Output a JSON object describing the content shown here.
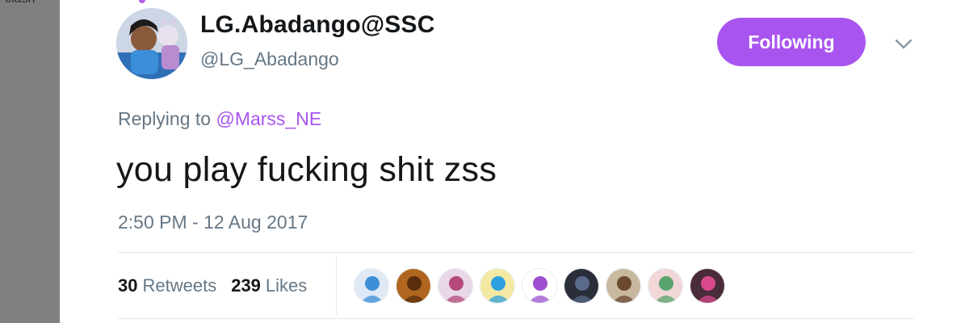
{
  "sidebar": {
    "partial_text": "clash"
  },
  "tweet": {
    "display_name": "LG.Abadango@SSC",
    "username": "@LG_Abadango",
    "follow_button": "Following",
    "replying_prefix": "Replying to",
    "replying_to": "@Marss_NE",
    "text": "you play fucking shit zss",
    "timestamp": "2:50 PM - 12 Aug 2017",
    "retweets_count": "30",
    "retweets_label": "Retweets",
    "likes_count": "239",
    "likes_label": "Likes"
  },
  "likers": [
    {
      "icon": "liker-avatar-1",
      "colors": [
        "#dfe9f5",
        "#3a8fd6"
      ]
    },
    {
      "icon": "liker-avatar-2",
      "colors": [
        "#b0661e",
        "#5a2d0c"
      ]
    },
    {
      "icon": "liker-avatar-3",
      "colors": [
        "#e8d7e6",
        "#b3497c"
      ]
    },
    {
      "icon": "liker-avatar-4",
      "colors": [
        "#f4e9a3",
        "#2ea0e0"
      ]
    },
    {
      "icon": "liker-avatar-5",
      "colors": [
        "#ffffff",
        "#9b4fcf"
      ]
    },
    {
      "icon": "liker-avatar-6",
      "colors": [
        "#2a2d3a",
        "#5a6a8a"
      ]
    },
    {
      "icon": "liker-avatar-7",
      "colors": [
        "#c8b8a0",
        "#6b4a30"
      ]
    },
    {
      "icon": "liker-avatar-8",
      "colors": [
        "#f1d7d7",
        "#5aa36d"
      ]
    },
    {
      "icon": "liker-avatar-9",
      "colors": [
        "#4a2b3a",
        "#d94a8c"
      ]
    }
  ],
  "colors": {
    "accent": "#a855f0",
    "text_primary": "#14171a",
    "text_secondary": "#657786",
    "sidebar_bg": "#808080"
  }
}
